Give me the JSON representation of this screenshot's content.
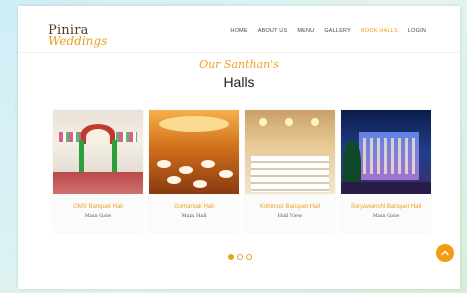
{
  "brand": {
    "line1": "Pinira",
    "line2": "Weddings"
  },
  "nav": {
    "items": [
      {
        "label": "HOME"
      },
      {
        "label": "ABOUT US"
      },
      {
        "label": "MENU"
      },
      {
        "label": "GALLERY"
      },
      {
        "label": "BOOK HALLS",
        "active": true
      },
      {
        "label": "LOGIN"
      }
    ]
  },
  "section": {
    "subtitle": "Our Santhan's",
    "title": "Halls"
  },
  "halls": [
    {
      "name": "GMS Banquet Hall",
      "location": "Main Gate"
    },
    {
      "name": "Gomantak Hall",
      "location": "Main Hall"
    },
    {
      "name": "Kohinoor Banquet Hall",
      "location": "Hall View"
    },
    {
      "name": "Suryawanshi Banquet Hall",
      "location": "Main Gate"
    }
  ],
  "carousel": {
    "page_count": 3,
    "active_page": 1
  },
  "colors": {
    "accent": "#f39c12",
    "brand_dark": "#5a3a2a"
  }
}
